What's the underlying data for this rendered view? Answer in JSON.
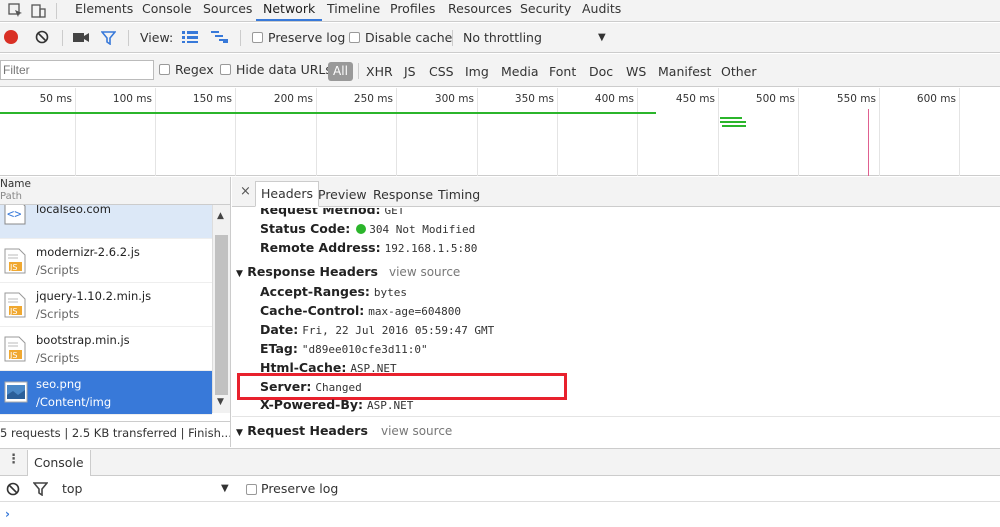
{
  "tabs": [
    "Elements",
    "Console",
    "Sources",
    "Network",
    "Timeline",
    "Profiles",
    "Resources",
    "Security",
    "Audits"
  ],
  "toolbar": {
    "view_label": "View:",
    "preserve_log": "Preserve log",
    "disable_cache": "Disable cache",
    "throttling": "No throttling"
  },
  "filterbar": {
    "placeholder": "Filter",
    "regex": "Regex",
    "hide_data_urls": "Hide data URLs",
    "all": "All",
    "types": [
      "XHR",
      "JS",
      "CSS",
      "Img",
      "Media",
      "Font",
      "Doc",
      "WS",
      "Manifest",
      "Other"
    ]
  },
  "overview": {
    "ticks": [
      "50 ms",
      "100 ms",
      "150 ms",
      "200 ms",
      "250 ms",
      "300 ms",
      "350 ms",
      "400 ms",
      "450 ms",
      "500 ms",
      "550 ms",
      "600 ms"
    ]
  },
  "requests": {
    "col_name": "Name",
    "col_path": "Path",
    "rows": [
      {
        "name": "localseo.com",
        "path": ""
      },
      {
        "name": "modernizr-2.6.2.js",
        "path": "/Scripts"
      },
      {
        "name": "jquery-1.10.2.min.js",
        "path": "/Scripts"
      },
      {
        "name": "bootstrap.min.js",
        "path": "/Scripts"
      },
      {
        "name": "seo.png",
        "path": "/Content/img"
      }
    ],
    "status": "5 requests  |  2.5 KB transferred  |  Finish..."
  },
  "details": {
    "tabs": [
      "Headers",
      "Preview",
      "Response",
      "Timing"
    ],
    "general": [
      {
        "key": "Request Method:",
        "value": "GET"
      },
      {
        "key": "Status Code:",
        "value": "304 Not Modified"
      },
      {
        "key": "Remote Address:",
        "value": "192.168.1.5:80"
      }
    ],
    "response_title": "Response Headers",
    "view_source": "view source",
    "response": [
      {
        "key": "Accept-Ranges:",
        "value": "bytes"
      },
      {
        "key": "Cache-Control:",
        "value": "max-age=604800"
      },
      {
        "key": "Date:",
        "value": "Fri, 22 Jul 2016 05:59:47 GMT"
      },
      {
        "key": "ETag:",
        "value": "\"d89ee010cfe3d11:0\""
      },
      {
        "key": "Html-Cache:",
        "value": "ASP.NET"
      },
      {
        "key": "Server:",
        "value": "Changed"
      },
      {
        "key": "X-Powered-By:",
        "value": "ASP.NET"
      }
    ],
    "request_title": "Request Headers"
  },
  "drawer": {
    "tab": "Console",
    "context": "top",
    "preserve_log": "Preserve log"
  },
  "colors": {
    "accent": "#3879d9",
    "record": "#d93025",
    "status_ok": "#2bb52b",
    "highlight": "#e8212d"
  }
}
